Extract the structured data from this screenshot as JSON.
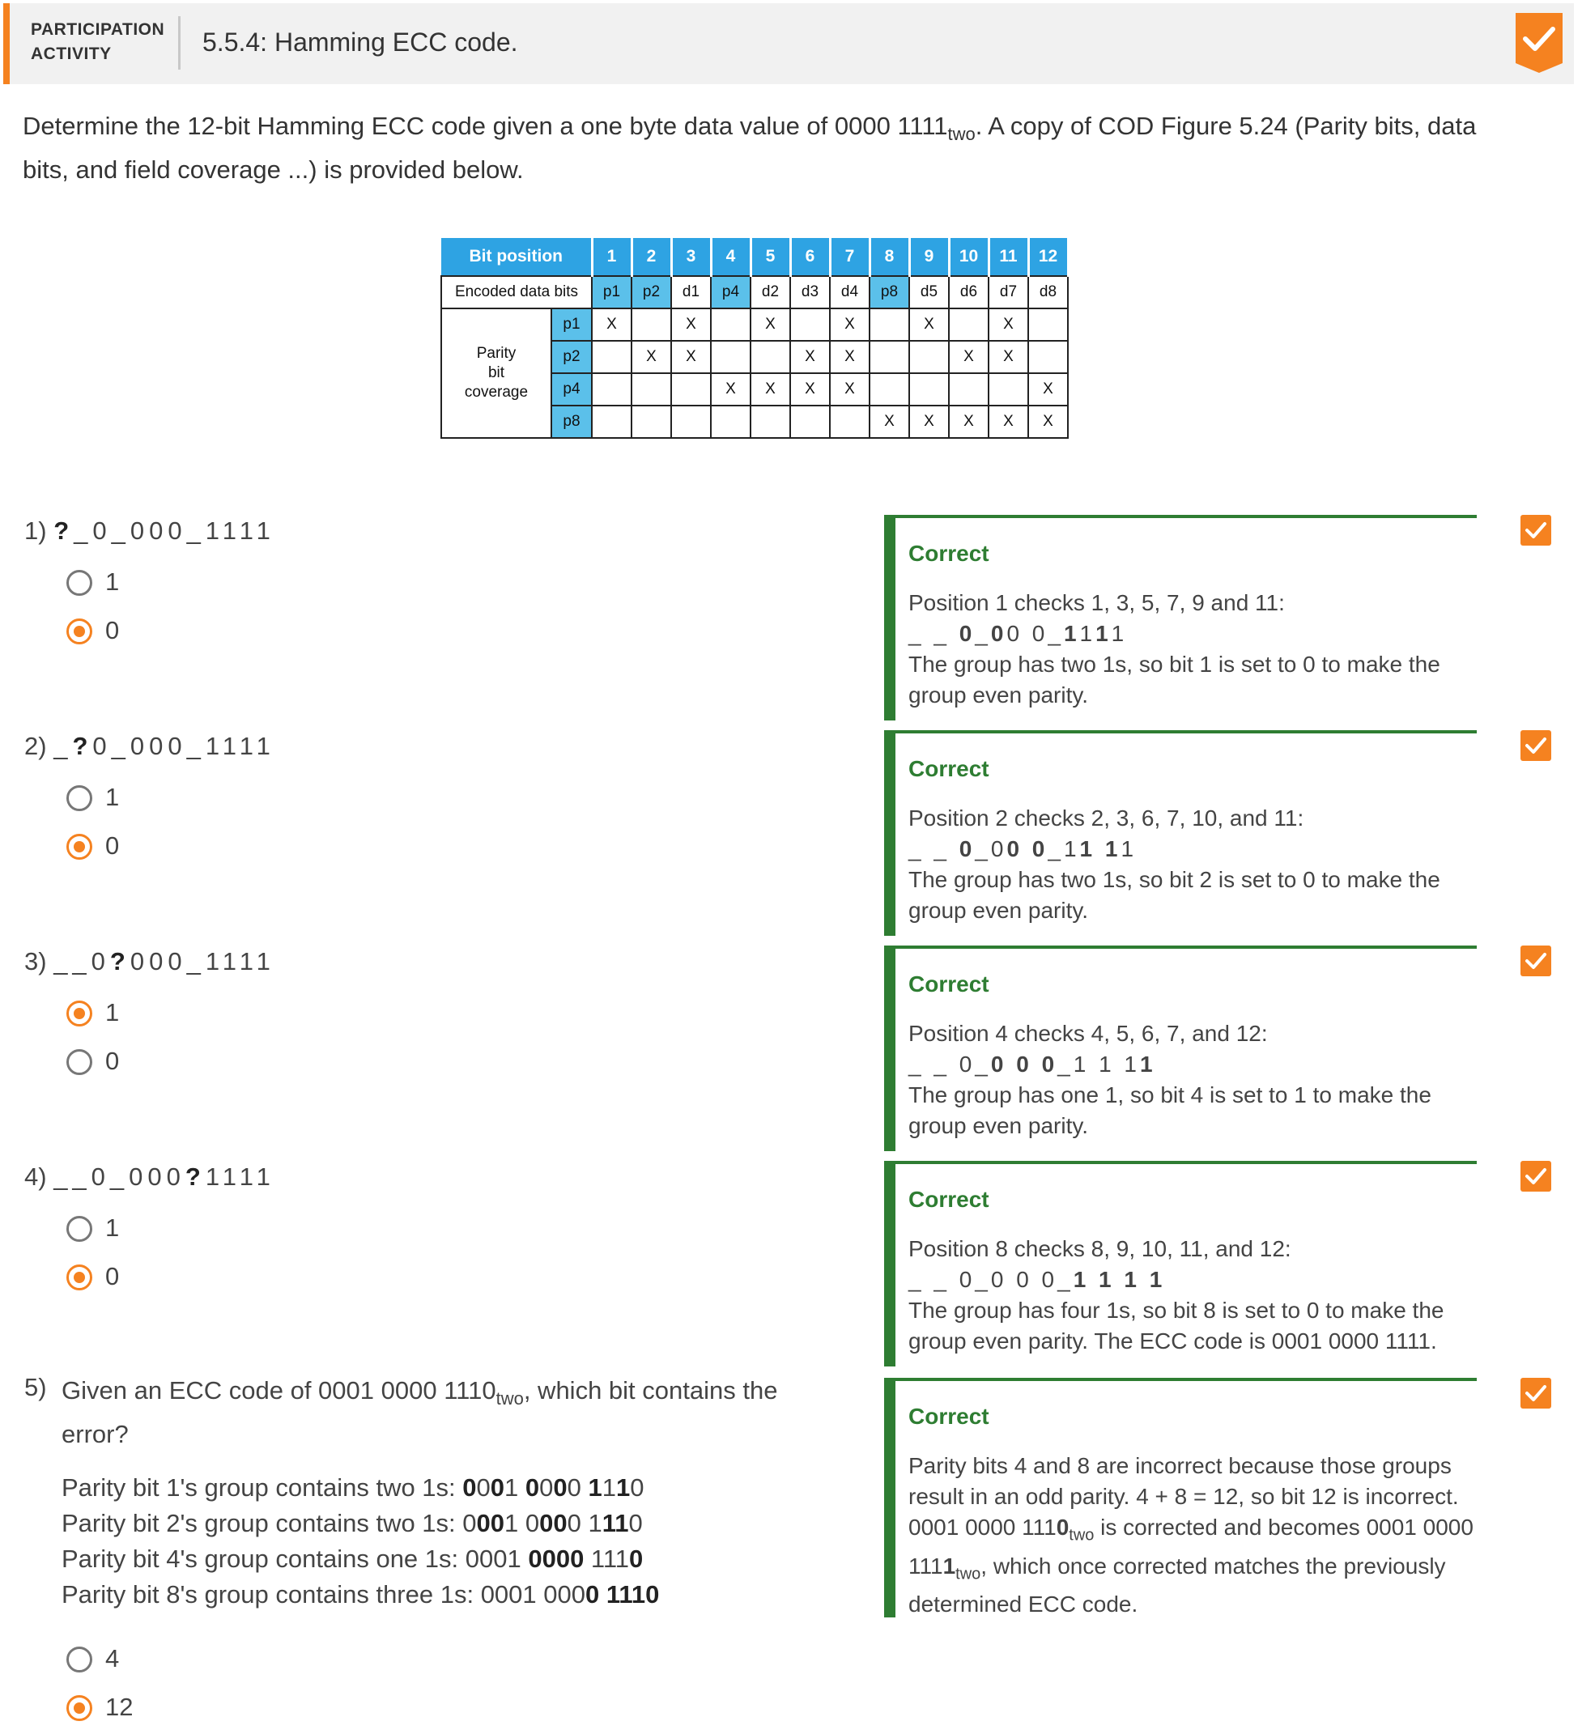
{
  "header": {
    "activity_line1": "PARTICIPATION",
    "activity_line2": "ACTIVITY",
    "title": "5.5.4: Hamming ECC code.",
    "accent_color": "#f58220",
    "completion_icon": "checkmark-badge-icon"
  },
  "intro": {
    "text_before": "Determine the 12-bit Hamming ECC code given a one byte data value of 0000 1111",
    "subscript": "two",
    "text_after": ". A copy of COD Figure 5.24 (Parity bits, data bits, and field coverage ...) is provided below."
  },
  "figure": {
    "bit_position_label": "Bit position",
    "positions": [
      "1",
      "2",
      "3",
      "4",
      "5",
      "6",
      "7",
      "8",
      "9",
      "10",
      "11",
      "12"
    ],
    "encoded_label": "Encoded data bits",
    "encoded": [
      "p1",
      "p2",
      "d1",
      "p4",
      "d2",
      "d3",
      "d4",
      "p8",
      "d5",
      "d6",
      "d7",
      "d8"
    ],
    "coverage_label_1": "Parity",
    "coverage_label_2": "bit",
    "coverage_label_3": "coverage",
    "coverage_rows": [
      {
        "name": "p1",
        "marks": [
          "X",
          "",
          "X",
          "",
          "X",
          "",
          "X",
          "",
          "X",
          "",
          "X",
          ""
        ]
      },
      {
        "name": "p2",
        "marks": [
          "",
          "X",
          "X",
          "",
          "",
          "X",
          "X",
          "",
          "",
          "X",
          "X",
          ""
        ]
      },
      {
        "name": "p4",
        "marks": [
          "",
          "",
          "",
          "X",
          "X",
          "X",
          "X",
          "",
          "",
          "",
          "",
          "X"
        ]
      },
      {
        "name": "p8",
        "marks": [
          "",
          "",
          "",
          "",
          "",
          "",
          "",
          "X",
          "X",
          "X",
          "X",
          "X"
        ]
      }
    ],
    "header_color": "#2ea3e3",
    "parity_color": "#5bc0ea"
  },
  "questions": [
    {
      "num": "1)",
      "pre": "",
      "mark": "?",
      "post": "_0_000_1111",
      "options": [
        "1",
        "0"
      ],
      "selected": 1,
      "feedback": {
        "status": "Correct",
        "line1": "Position 1 checks 1, 3, 5, 7, 9 and 11:",
        "bits_html": "_ _ <b>0</b>_<b>0</b>0 0_<b>1</b>1<b>1</b>1",
        "explain": "The group has two 1s, so bit 1 is set to 0 to make the group even parity."
      }
    },
    {
      "num": "2)",
      "pre": "_",
      "mark": "?",
      "post": "0_000_1111",
      "options": [
        "1",
        "0"
      ],
      "selected": 1,
      "feedback": {
        "status": "Correct",
        "line1": "Position 2 checks 2, 3, 6, 7, 10, and 11:",
        "bits_html": "_ _ <b>0</b>_0<b>0 0</b>_1<b>1 1</b>1",
        "explain": "The group has two 1s, so bit 2 is set to 0 to make the group even parity."
      }
    },
    {
      "num": "3)",
      "pre": "__0",
      "mark": "?",
      "post": "000_1111",
      "options": [
        "1",
        "0"
      ],
      "selected": 0,
      "feedback": {
        "status": "Correct",
        "line1": "Position 4 checks 4, 5, 6, 7, and 12:",
        "bits_html": "_ _ 0_<b>0 0 0</b>_1 1 1<b>1</b>",
        "explain": "The group has one 1, so bit 4 is set to 1 to make the group even parity."
      }
    },
    {
      "num": "4)",
      "pre": "__0_000",
      "mark": "?",
      "post": "1111",
      "options": [
        "1",
        "0"
      ],
      "selected": 1,
      "feedback": {
        "status": "Correct",
        "line1": "Position 8 checks 8, 9, 10, 11, and 12:",
        "bits_html": "_ _ 0_0 0 0_<b>1 1 1 1</b>",
        "explain": "The group has four 1s, so bit 8 is set to 0 to make the group even parity. The ECC code is 0001 0000 1111."
      }
    }
  ],
  "q5": {
    "num": "5)",
    "text_before": "Given an ECC code of 0001 0000 1110",
    "subscript": "two",
    "text_after": ", which bit contains the error?",
    "lines_html": [
      "Parity bit 1's group contains two 1s: <b>0</b>0<b>0</b>1 <b>0</b>0<b>0</b>0 <b>1</b>1<b>1</b>0",
      "Parity bit 2's group contains two 1s: 0<b>00</b>1 0<b>00</b>0 1<b>11</b>0",
      "Parity bit 4's group contains one 1s: 0001 <b>0000</b> 111<b>0</b>",
      "Parity bit 8's group contains three 1s: 0001 000<b>0 1110</b>"
    ],
    "options": [
      "4",
      "12"
    ],
    "selected": 1,
    "feedback": {
      "status": "Correct",
      "text_html": "Parity bits 4 and 8 are incorrect because those groups result in an odd parity. 4 + 8 = 12, so bit 12 is incorrect. 0001 0000 111<b>0</b><sub>two</sub> is corrected and becomes 0001 0000 111<b>1</b><sub>two</sub>, which once corrected matches the previously determined ECC code."
    }
  },
  "colors": {
    "correct": "#2e7d32",
    "radio_selected": "#f58220",
    "check_badge": "#f58220"
  }
}
